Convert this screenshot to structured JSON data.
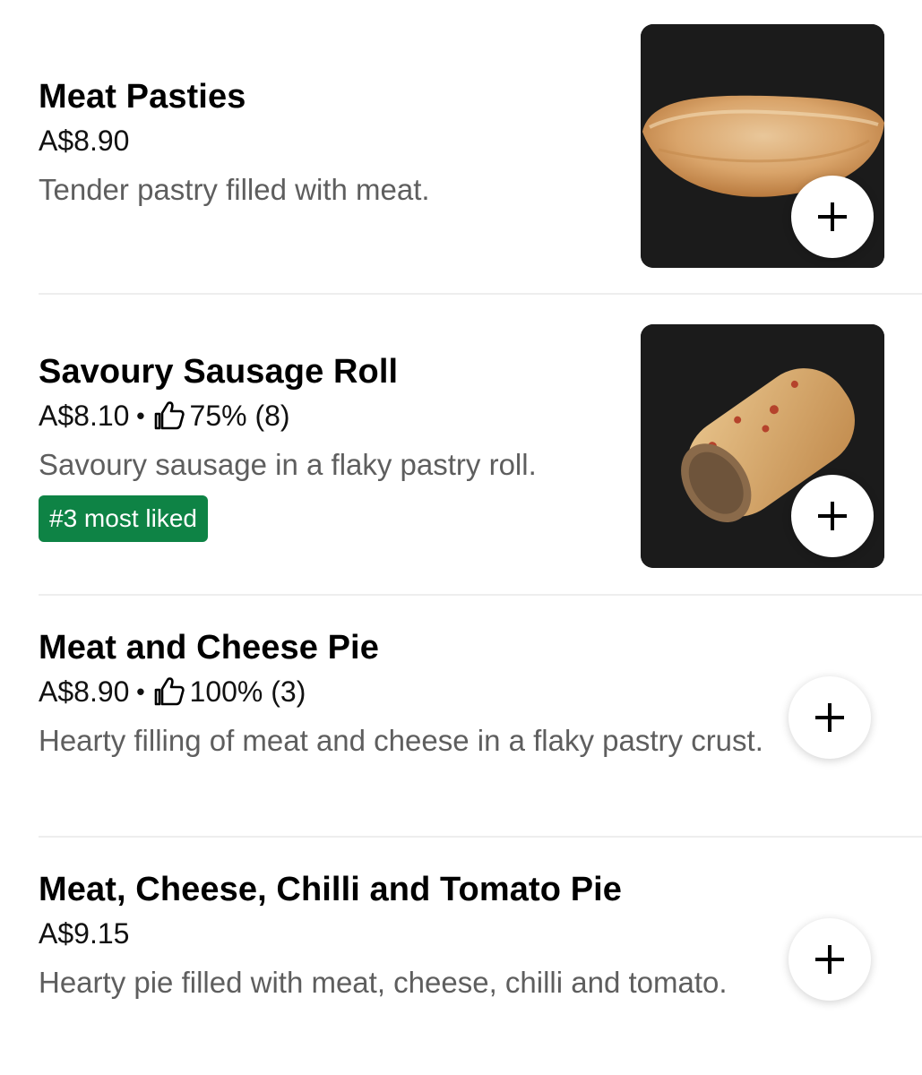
{
  "items": [
    {
      "name": "Meat Pasties",
      "price": "A$8.90",
      "description": "Tender pastry filled with meat.",
      "image": "meat-pasty-photo"
    },
    {
      "name": "Savoury Sausage Roll",
      "price": "A$8.10",
      "separator": "•",
      "rating": "75% (8)",
      "description": "Savoury sausage in a flaky pastry roll.",
      "badge": "#3 most liked",
      "image": "sausage-roll-photo"
    },
    {
      "name": "Meat and Cheese Pie",
      "price": "A$8.90",
      "separator": "•",
      "rating": "100% (3)",
      "description": "Hearty filling of meat and cheese in a flaky pastry crust."
    },
    {
      "name": "Meat, Cheese, Chilli and Tomato Pie",
      "price": "A$9.15",
      "description": "Hearty pie filled with meat, cheese, chilli and tomato."
    }
  ],
  "icons": {
    "add": "plus-icon",
    "rating": "thumbs-up-icon"
  },
  "colors": {
    "badge_bg": "#0E8345",
    "description_text": "#5E5E5E",
    "image_bg": "#1B1B1B"
  }
}
